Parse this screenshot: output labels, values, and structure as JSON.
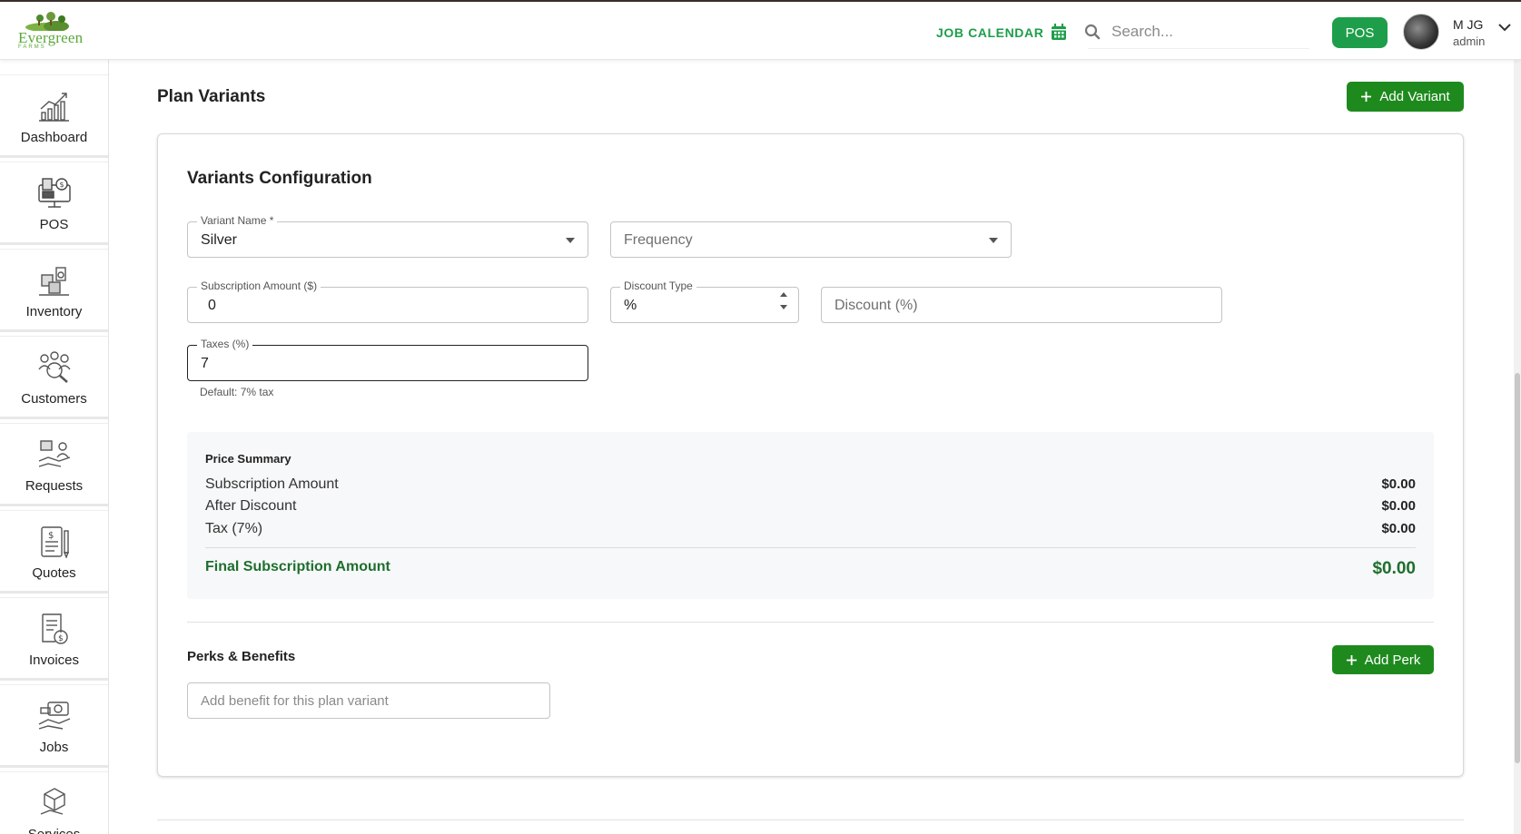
{
  "header": {
    "logo_word": "Evergreen",
    "logo_sub": "FARMS",
    "job_calendar_label": "JOB CALENDAR",
    "search_placeholder": "Search...",
    "pos_label": "POS",
    "user_name": "M JG",
    "user_role": "admin"
  },
  "sidebar": {
    "items": [
      {
        "label": "Dashboard",
        "icon": "chart-icon"
      },
      {
        "label": "POS",
        "icon": "pos-terminal-icon"
      },
      {
        "label": "Inventory",
        "icon": "inventory-icon"
      },
      {
        "label": "Customers",
        "icon": "customers-icon"
      },
      {
        "label": "Requests",
        "icon": "requests-icon"
      },
      {
        "label": "Quotes",
        "icon": "quotes-icon"
      },
      {
        "label": "Invoices",
        "icon": "invoices-icon"
      },
      {
        "label": "Jobs",
        "icon": "jobs-icon"
      },
      {
        "label": "Services",
        "icon": "services-icon"
      }
    ]
  },
  "main": {
    "section_title": "Plan Variants",
    "add_variant_label": "Add Variant",
    "card_title": "Variants Configuration",
    "variant_name": {
      "label": "Variant Name *",
      "value": "Silver"
    },
    "frequency": {
      "placeholder": "Frequency"
    },
    "subscription_amount": {
      "label": "Subscription Amount ($)",
      "value": "0"
    },
    "discount_type": {
      "label": "Discount Type",
      "value": "%"
    },
    "discount": {
      "placeholder": "Discount (%)"
    },
    "taxes": {
      "label": "Taxes (%)",
      "value": "7",
      "helper": "Default: 7% tax"
    },
    "price_summary": {
      "title": "Price Summary",
      "rows": [
        {
          "label": "Subscription Amount",
          "value": "$0.00"
        },
        {
          "label": "After Discount",
          "value": "$0.00"
        },
        {
          "label": "Tax (7%)",
          "value": "$0.00"
        }
      ],
      "final_label": "Final Subscription Amount",
      "final_value": "$0.00"
    },
    "perks": {
      "title": "Perks & Benefits",
      "add_perk_label": "Add Perk",
      "input_placeholder": "Add benefit for this plan variant"
    }
  },
  "colors": {
    "accent": "#1e9e4a",
    "button_green": "#1e8a1e",
    "final_green": "#1e6e2e"
  }
}
